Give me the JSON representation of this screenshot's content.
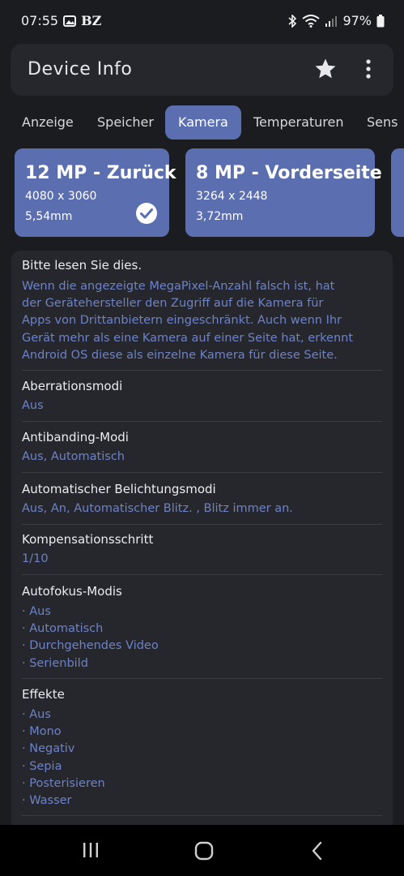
{
  "status": {
    "time": "07:55",
    "carrier": "BZ",
    "battery": "97%"
  },
  "app": {
    "title": "Device Info"
  },
  "tabs": [
    "Anzeige",
    "Speicher",
    "Kamera",
    "Temperaturen",
    "Sens"
  ],
  "cameras": [
    {
      "title": "12 MP - Zurück",
      "resolution": "4080 x 3060",
      "focal": "5,54mm",
      "selected": true
    },
    {
      "title": "8 MP - Vorderseite",
      "resolution": "3264 x 2448",
      "focal": "3,72mm",
      "selected": false
    }
  ],
  "notice": {
    "title": "Bitte lesen Sie dies.",
    "lines": [
      "Wenn die angezeigte MegaPixel-Anzahl falsch ist, hat",
      "der Gerätehersteller den Zugriff auf die Kamera für",
      "Apps von Drittanbietern eingeschränkt. Auch wenn Ihr",
      "Gerät mehr als eine Kamera auf einer Seite hat, erkennt",
      "Android OS diese als einzelne Kamera für diese Seite."
    ]
  },
  "props": {
    "aberration": {
      "label": "Aberrationsmodi",
      "value": "Aus"
    },
    "antibanding": {
      "label": "Antibanding-Modi",
      "value": "Aus, Automatisch"
    },
    "exposure": {
      "label": "Automatischer Belichtungsmodi",
      "value": "Aus, An, Automatischer Blitz. , Blitz immer an."
    },
    "compensation": {
      "label": "Kompensationsschritt",
      "value": "1/10"
    },
    "autofocus": {
      "label": "Autofokus-Modis",
      "items": [
        "· Aus",
        "· Automatisch",
        "· Durchgehendes Video",
        "· Serienbild"
      ]
    },
    "effects": {
      "label": "Effekte",
      "items": [
        "· Aus",
        "· Mono",
        "· Negativ",
        "· Sepia",
        "· Posterisieren",
        "· Wasser"
      ]
    }
  },
  "colors": {
    "accent": "#5b6fb0",
    "link_text": "#6d82c8",
    "surface": "#26272c",
    "background": "#1b1c20"
  },
  "icons": [
    "image-icon",
    "bluetooth-icon",
    "wifi-icon",
    "signal-icon",
    "battery-icon",
    "star-icon",
    "more-vert-icon",
    "check-circle-icon",
    "recents-icon",
    "home-icon",
    "back-icon"
  ]
}
